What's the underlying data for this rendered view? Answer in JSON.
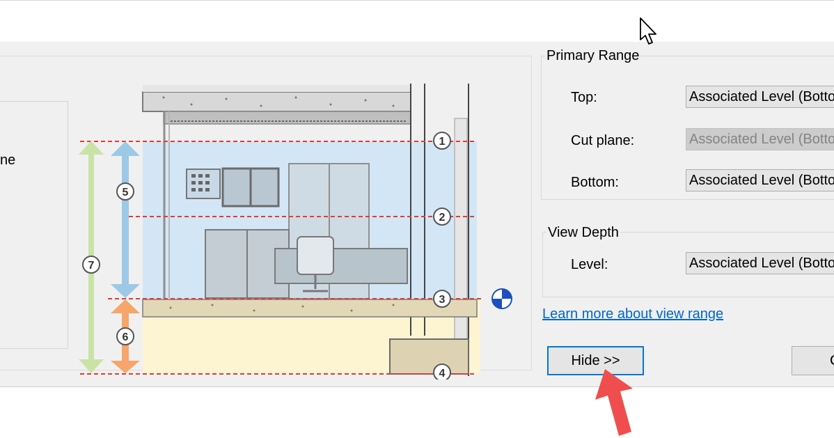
{
  "dialog": {
    "left_partial_text": "ne",
    "primary_range": {
      "title": "Primary Range",
      "top_label": "Top:",
      "top_value": "Associated Level (Bottom)",
      "cut_plane_label": "Cut plane:",
      "cut_plane_value": "Associated Level (Bottom)",
      "bottom_label": "Bottom:",
      "bottom_value": "Associated Level (Bottom)"
    },
    "view_depth": {
      "title": "View Depth",
      "level_label": "Level:",
      "level_value": "Associated Level (Bottom)"
    },
    "learn_link": "Learn more about view range",
    "hide_button": "Hide >>",
    "other_button_partial": "C"
  },
  "diagram": {
    "markers": [
      "1",
      "2",
      "3",
      "4",
      "5",
      "6",
      "7"
    ],
    "colors": {
      "primary_range": "#d3e6f5",
      "view_depth": "#fdf4d2",
      "red_line": "#e53935",
      "blue_arrow": "#9cc9e6",
      "orange_arrow": "#f6a66a",
      "green_arrow": "#c9e3a6"
    }
  },
  "icons": [
    "mouse-pointer-icon",
    "red-arrow-icon",
    "level-datum-icon"
  ]
}
